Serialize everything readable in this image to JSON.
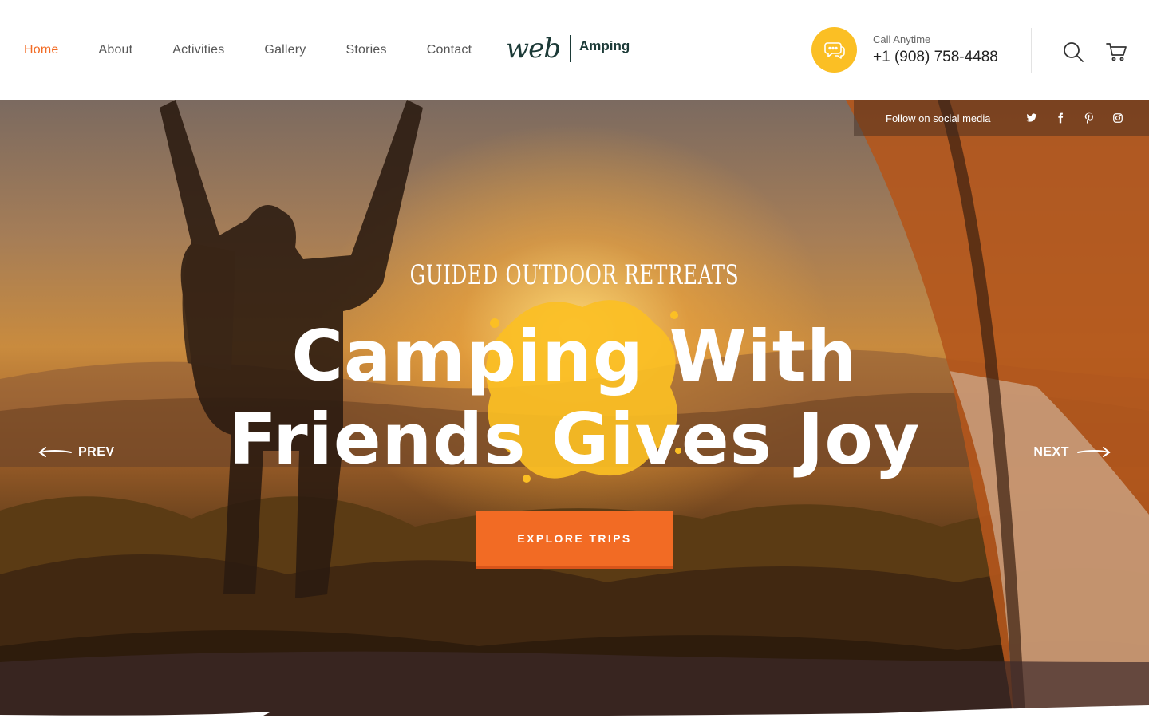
{
  "nav": {
    "items": [
      {
        "label": "Home",
        "active": true
      },
      {
        "label": "About",
        "active": false
      },
      {
        "label": "Activities",
        "active": false
      },
      {
        "label": "Gallery",
        "active": false
      },
      {
        "label": "Stories",
        "active": false
      },
      {
        "label": "Contact",
        "active": false
      }
    ]
  },
  "logo": {
    "script": "web",
    "word": "Amping"
  },
  "contact": {
    "label": "Call Anytime",
    "phone": "+1 (908) 758-4488",
    "icon": "chat-bubble-icon"
  },
  "header_actions": {
    "search_icon": "search-icon",
    "cart_icon": "cart-icon"
  },
  "social": {
    "label": "Follow on social media",
    "icons": [
      "twitter-icon",
      "facebook-icon",
      "pinterest-icon",
      "instagram-icon"
    ]
  },
  "hero": {
    "subtitle": "GUIDED OUTDOOR RETREATS",
    "title_line1": "Camping With",
    "title_line2": "Friends Gives Joy",
    "cta_label": "EXPLORE TRIPS",
    "prev_label": "PREV",
    "next_label": "NEXT"
  },
  "colors": {
    "accent_orange": "#f26b24",
    "accent_yellow": "#fbbf24",
    "brand_dark": "#1c3a37",
    "nav_text": "#555555"
  }
}
